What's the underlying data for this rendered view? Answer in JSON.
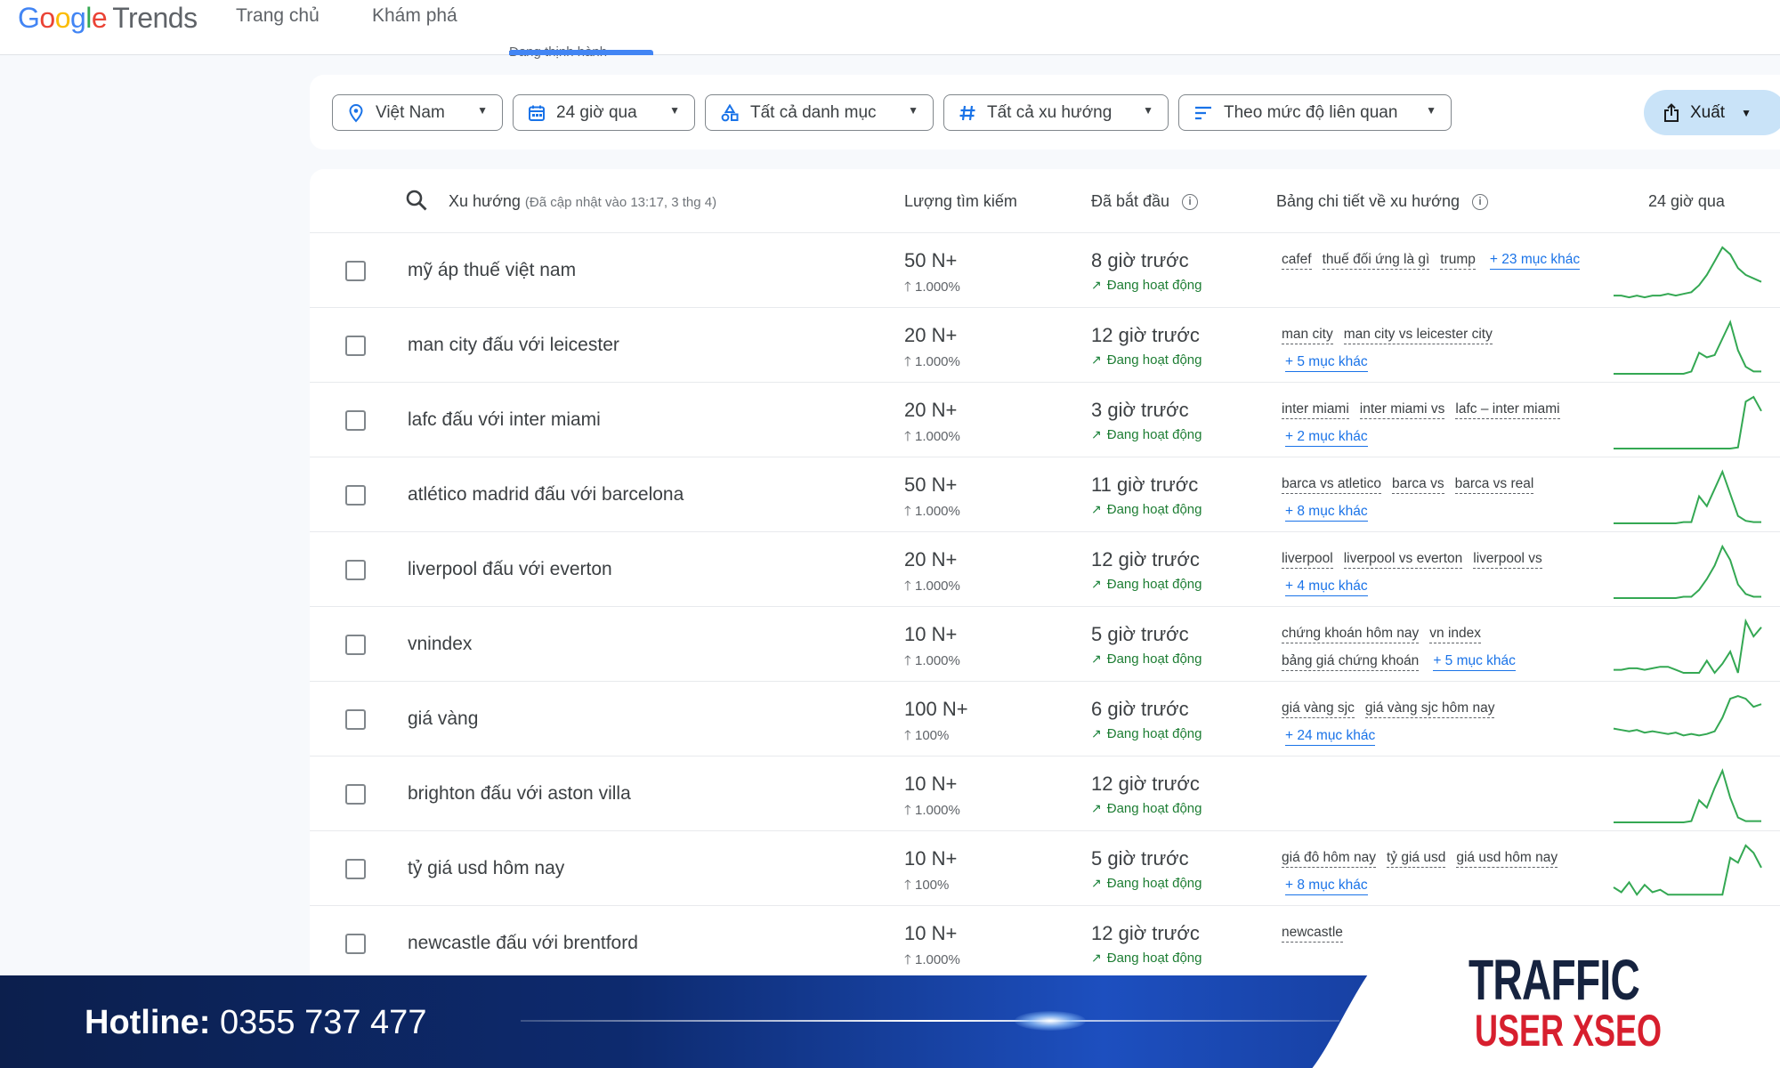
{
  "app": {
    "logo": "Google",
    "logo_trends": "Trends",
    "nav": [
      "Trang chủ",
      "Khám phá",
      "Đang thịnh hành"
    ]
  },
  "filters": {
    "location": "Việt Nam",
    "time": "24 giờ qua",
    "category": "Tất cả danh mục",
    "trend_type": "Tất cả xu hướng",
    "sort": "Theo mức độ liên quan",
    "export": "Xuất"
  },
  "table": {
    "headers": {
      "trend": "Xu hướng",
      "updated": "(Đã cập nhật vào 13:17, 3 thg 4)",
      "volume": "Lượng tìm kiếm",
      "started": "Đã bắt đầu",
      "breakdown": "Bảng chi tiết về xu hướng",
      "range": "24 giờ qua"
    },
    "rows": [
      {
        "title": "mỹ áp thuế việt nam",
        "volume": "50 N+",
        "pct": "1.000%",
        "started": "8 giờ trước",
        "status": "Đang hoạt động",
        "tags": [
          "cafef",
          "thuế đối ứng là gì",
          "trump"
        ],
        "more": "+ 23 mục khác",
        "spark": [
          2,
          2,
          1,
          2,
          1,
          2,
          2,
          3,
          2,
          3,
          4,
          8,
          14,
          22,
          30,
          26,
          18,
          14,
          12,
          10
        ]
      },
      {
        "title": "man city đấu với leicester",
        "volume": "20 N+",
        "pct": "1.000%",
        "started": "12 giờ trước",
        "status": "Đang hoạt động",
        "tags": [
          "man city",
          "man city vs leicester city"
        ],
        "more": "+ 5 mục khác",
        "spark": [
          0,
          0,
          0,
          0,
          0,
          0,
          0,
          0,
          0,
          0,
          2,
          18,
          14,
          16,
          30,
          44,
          20,
          6,
          2,
          2
        ]
      },
      {
        "title": "lafc đấu với inter miami",
        "volume": "20 N+",
        "pct": "1.000%",
        "started": "3 giờ trước",
        "status": "Đang hoạt động",
        "tags": [
          "inter miami",
          "inter miami vs",
          "lafc – inter miami"
        ],
        "more": "+ 2 mục khác",
        "spark": [
          0,
          0,
          0,
          0,
          0,
          0,
          0,
          0,
          0,
          0,
          0,
          0,
          0,
          0,
          0,
          0,
          1,
          40,
          44,
          32
        ]
      },
      {
        "title": "atlético madrid đấu với barcelona",
        "volume": "50 N+",
        "pct": "1.000%",
        "started": "11 giờ trước",
        "status": "Đang hoạt động",
        "tags": [
          "barca vs atletico",
          "barca vs",
          "barca vs real"
        ],
        "more": "+ 8 mục khác",
        "spark": [
          0,
          0,
          0,
          0,
          0,
          0,
          0,
          0,
          0,
          1,
          1,
          22,
          14,
          28,
          42,
          24,
          6,
          2,
          1,
          1
        ]
      },
      {
        "title": "liverpool đấu với everton",
        "volume": "20 N+",
        "pct": "1.000%",
        "started": "12 giờ trước",
        "status": "Đang hoạt động",
        "tags": [
          "liverpool",
          "liverpool vs everton",
          "liverpool vs"
        ],
        "more": "+ 4 mục khác",
        "spark": [
          0,
          0,
          0,
          0,
          0,
          0,
          0,
          0,
          0,
          1,
          1,
          6,
          14,
          24,
          38,
          28,
          10,
          3,
          1,
          1
        ]
      },
      {
        "title": "vnindex",
        "volume": "10 N+",
        "pct": "1.000%",
        "started": "5 giờ trước",
        "status": "Đang hoạt động",
        "tags": [
          "chứng khoán hôm nay",
          "vn index",
          "bảng giá chứng khoán"
        ],
        "more": "+ 5 mục khác",
        "spark": [
          2,
          2,
          3,
          3,
          2,
          3,
          4,
          4,
          2,
          0,
          0,
          0,
          8,
          0,
          6,
          14,
          0,
          34,
          24,
          30
        ]
      },
      {
        "title": "giá vàng",
        "volume": "100 N+",
        "pct": "100%",
        "started": "6 giờ trước",
        "status": "Đang hoạt động",
        "tags": [
          "giá vàng sjc",
          "giá vàng sjc hôm nay"
        ],
        "more": "+ 24 mục khác",
        "spark": [
          14,
          13,
          12,
          13,
          11,
          12,
          11,
          10,
          11,
          9,
          10,
          9,
          10,
          12,
          22,
          36,
          38,
          36,
          30,
          32
        ]
      },
      {
        "title": "brighton đấu với aston villa",
        "volume": "10 N+",
        "pct": "1.000%",
        "started": "12 giờ trước",
        "status": "Đang hoạt động",
        "tags": [],
        "more": "",
        "spark": [
          0,
          0,
          0,
          0,
          0,
          0,
          0,
          0,
          0,
          0,
          1,
          18,
          12,
          28,
          42,
          20,
          4,
          1,
          1,
          1
        ]
      },
      {
        "title": "tỷ giá usd hôm nay",
        "volume": "10 N+",
        "pct": "100%",
        "started": "5 giờ trước",
        "status": "Đang hoạt động",
        "tags": [
          "giá đô hôm nay",
          "tỷ giá usd",
          "giá usd hôm nay"
        ],
        "more": "+ 8 mục khác",
        "spark": [
          8,
          4,
          12,
          2,
          10,
          4,
          6,
          2,
          2,
          2,
          2,
          2,
          2,
          2,
          2,
          32,
          28,
          42,
          36,
          24
        ]
      },
      {
        "title": "newcastle đấu với brentford",
        "volume": "10 N+",
        "pct": "1.000%",
        "started": "12 giờ trước",
        "status": "Đang hoạt động",
        "tags": [
          "newcastle"
        ],
        "more": "",
        "spark": [
          0,
          0,
          0,
          0,
          0,
          0,
          0,
          0,
          0,
          0,
          0,
          0,
          0,
          0,
          0,
          0,
          0,
          0,
          0,
          0
        ]
      }
    ]
  },
  "footer": {
    "hotline_label": "Hotline:",
    "hotline_number": "0355 737 477",
    "brand_line1": "TRAFFIC",
    "brand_line2": "USER XSEO"
  },
  "colors": {
    "accent": "#4285f4",
    "spark": "#34a853",
    "active_green": "#188038",
    "link_blue": "#1a73e8",
    "brand_red": "#d71f2e"
  }
}
